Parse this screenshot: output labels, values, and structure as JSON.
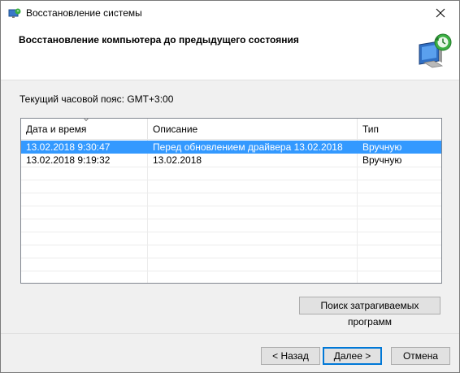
{
  "window": {
    "title": "Восстановление системы"
  },
  "header": {
    "title": "Восстановление компьютера до предыдущего состояния",
    "icon": "system-restore-icon"
  },
  "timezone": {
    "label": "Текущий часовой пояс: GMT+3:00"
  },
  "list": {
    "columns": [
      "Дата и время",
      "Описание",
      "Тип"
    ],
    "sorted_column": "Дата и время",
    "rows": [
      {
        "datetime": "13.02.2018 9:30:47",
        "description": "Перед обновлением драйвера 13.02.2018",
        "type": "Вручную",
        "selected": true
      },
      {
        "datetime": "13.02.2018 9:19:32",
        "description": "13.02.2018",
        "type": "Вручную",
        "selected": false
      }
    ]
  },
  "buttons": {
    "scan": "Поиск затрагиваемых программ",
    "back": "< Назад",
    "next": "Далее >",
    "cancel": "Отмена"
  },
  "colors": {
    "selection": "#3399ff",
    "default_button_border": "#0078d7"
  }
}
